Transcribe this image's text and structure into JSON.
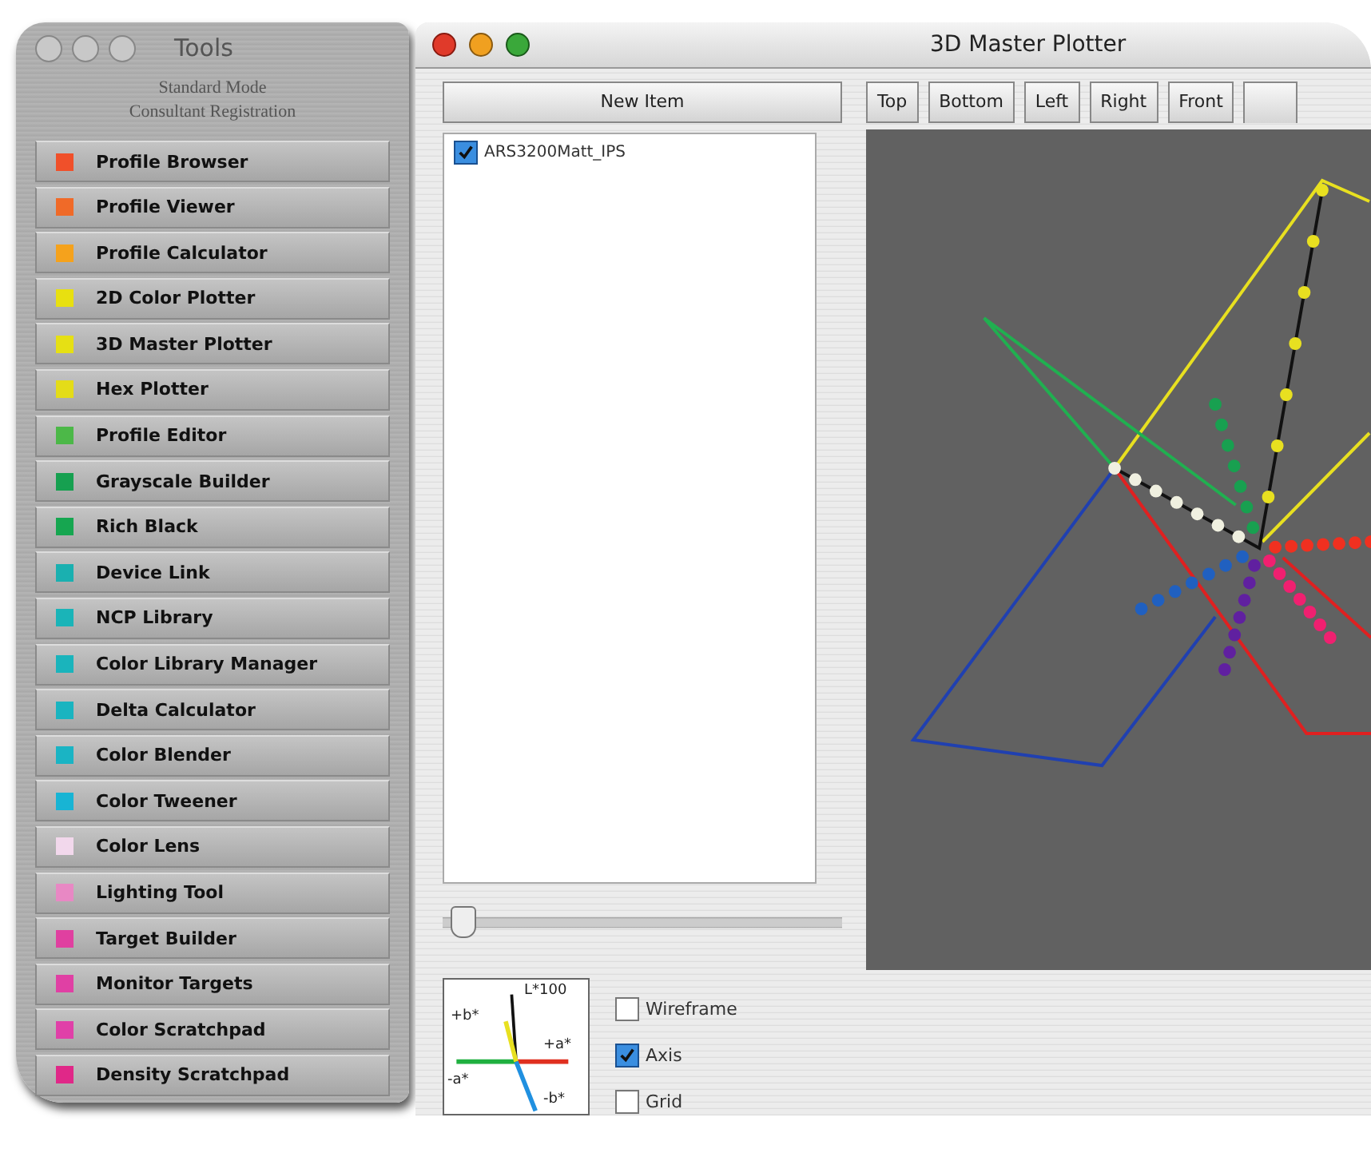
{
  "tools_window": {
    "title": "Tools",
    "subtitle_lines": [
      "Standard Mode",
      "Consultant Registration"
    ],
    "items": [
      {
        "label": "Profile Browser",
        "color": "#f0502a"
      },
      {
        "label": "Profile Viewer",
        "color": "#f06a28"
      },
      {
        "label": "Profile Calculator",
        "color": "#f5a21c"
      },
      {
        "label": "2D Color Plotter",
        "color": "#e8e010"
      },
      {
        "label": "3D Master Plotter",
        "color": "#e6e014"
      },
      {
        "label": "Hex Plotter",
        "color": "#e4dc18"
      },
      {
        "label": "Profile Editor",
        "color": "#4cb848"
      },
      {
        "label": "Grayscale Builder",
        "color": "#16a050"
      },
      {
        "label": "Rich Black",
        "color": "#16a650"
      },
      {
        "label": "Device Link",
        "color": "#1ab0b0"
      },
      {
        "label": "NCP Library",
        "color": "#1ab4b8"
      },
      {
        "label": "Color Library Manager",
        "color": "#1ab4bc"
      },
      {
        "label": "Delta Calculator",
        "color": "#1ab4c0"
      },
      {
        "label": "Color Blender",
        "color": "#1ab4c4"
      },
      {
        "label": "Color Tweener",
        "color": "#18b4d4"
      },
      {
        "label": "Color Lens",
        "color": "#f2d8ec"
      },
      {
        "label": "Lighting Tool",
        "color": "#e888c4"
      },
      {
        "label": "Target Builder",
        "color": "#e040a0"
      },
      {
        "label": "Monitor Targets",
        "color": "#e040a4"
      },
      {
        "label": "Color Scratchpad",
        "color": "#e040a8"
      },
      {
        "label": "Density  Scratchpad",
        "color": "#e02888"
      }
    ]
  },
  "plotter_window": {
    "title": "3D Master Plotter",
    "new_item_button": "New Item",
    "view_buttons": [
      "Top",
      "Bottom",
      "Left",
      "Right",
      "Front"
    ],
    "items": [
      {
        "label": "ARS3200Matt_IPS",
        "checked": true
      }
    ],
    "zoom_slider": {
      "level": 0.02
    },
    "axis_labels": [
      "L*100",
      "+b*",
      "+a*",
      "-a*",
      "-b*"
    ],
    "options": [
      {
        "label": "Wireframe",
        "checked": false
      },
      {
        "label": "Axis",
        "checked": true
      },
      {
        "label": "Grid",
        "checked": false
      }
    ]
  }
}
